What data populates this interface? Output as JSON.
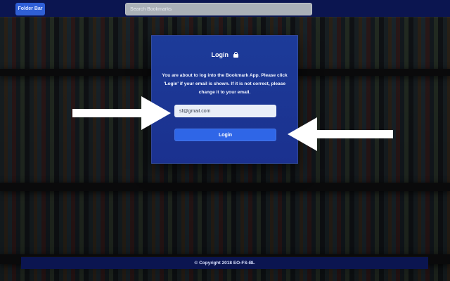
{
  "topbar": {
    "folder_button_label": "Folder Bar",
    "search_placeholder": "Search Bookmarks"
  },
  "modal": {
    "title": "Login",
    "message": "You are about to log into the Bookmark App. Please click 'Login' if your email is shown. If it is not correct, please change it to your email.",
    "email_value": "sf@gmail.com",
    "login_button_label": "Login"
  },
  "footer": {
    "text": "© Copyright 2018 EO-FS-BL"
  },
  "icons": {
    "lock": "lock-icon",
    "arrow_left": "arrow-right-icon",
    "arrow_right": "arrow-left-icon"
  },
  "colors": {
    "topbar_bg": "#0b1550",
    "folder_button_bg": "#2f5fd6",
    "modal_bg_top": "#1c3b99",
    "modal_bg_bottom": "#1b318f",
    "login_button_bg": "#2f66e7",
    "footer_bg": "#0b1550"
  }
}
